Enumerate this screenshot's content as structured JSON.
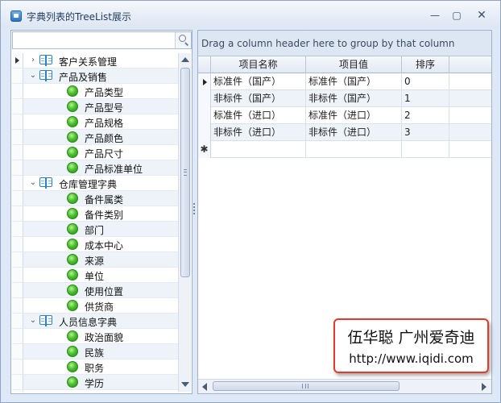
{
  "window": {
    "title": "字典列表的TreeList展示",
    "minimize": "—",
    "maximize": "▢",
    "close": "✕"
  },
  "search": {
    "value": "",
    "placeholder": ""
  },
  "tree": [
    {
      "label": "客户关系管理",
      "type": "group",
      "expanded": false,
      "level": 0,
      "current": true
    },
    {
      "label": "产品及销售",
      "type": "group",
      "expanded": true,
      "level": 0
    },
    {
      "label": "产品类型",
      "type": "leaf",
      "level": 1
    },
    {
      "label": "产品型号",
      "type": "leaf",
      "level": 1
    },
    {
      "label": "产品规格",
      "type": "leaf",
      "level": 1
    },
    {
      "label": "产品颜色",
      "type": "leaf",
      "level": 1
    },
    {
      "label": "产品尺寸",
      "type": "leaf",
      "level": 1
    },
    {
      "label": "产品标准单位",
      "type": "leaf",
      "level": 1
    },
    {
      "label": "仓库管理字典",
      "type": "group",
      "expanded": true,
      "level": 0
    },
    {
      "label": "备件属类",
      "type": "leaf",
      "level": 1
    },
    {
      "label": "备件类别",
      "type": "leaf",
      "level": 1
    },
    {
      "label": "部门",
      "type": "leaf",
      "level": 1
    },
    {
      "label": "成本中心",
      "type": "leaf",
      "level": 1
    },
    {
      "label": "来源",
      "type": "leaf",
      "level": 1
    },
    {
      "label": "单位",
      "type": "leaf",
      "level": 1
    },
    {
      "label": "使用位置",
      "type": "leaf",
      "level": 1
    },
    {
      "label": "供货商",
      "type": "leaf",
      "level": 1
    },
    {
      "label": "人员信息字典",
      "type": "group",
      "expanded": true,
      "level": 0
    },
    {
      "label": "政治面貌",
      "type": "leaf",
      "level": 1
    },
    {
      "label": "民族",
      "type": "leaf",
      "level": 1
    },
    {
      "label": "职务",
      "type": "leaf",
      "level": 1
    },
    {
      "label": "学历",
      "type": "leaf",
      "level": 1
    },
    {
      "label": "",
      "type": "leaf",
      "level": 1
    }
  ],
  "group_panel": {
    "text": "Drag a column header here to group by that column"
  },
  "grid": {
    "columns": [
      "项目名称",
      "项目值",
      "排序"
    ],
    "rows": [
      [
        "标准件（国产）",
        "标准件（国产）",
        "0"
      ],
      [
        "非标件（国产）",
        "非标件（国产）",
        "1"
      ],
      [
        "标准件（进口）",
        "标准件（进口）",
        "2"
      ],
      [
        "非标件（进口）",
        "非标件（进口）",
        "3"
      ]
    ],
    "new_row_marker": "✱"
  },
  "watermark": {
    "line1": "伍华聪 广州爱奇迪",
    "line2": "http://www.iqidi.com"
  },
  "colors": {
    "accent": "#2c82c9",
    "leaf_green": "#4cc12c",
    "watermark_border": "#e23b2e",
    "panel_bg": "#dfe8f6"
  },
  "icons": {
    "group": "book-icon",
    "leaf": "green-dot-icon",
    "search": "search-icon"
  }
}
